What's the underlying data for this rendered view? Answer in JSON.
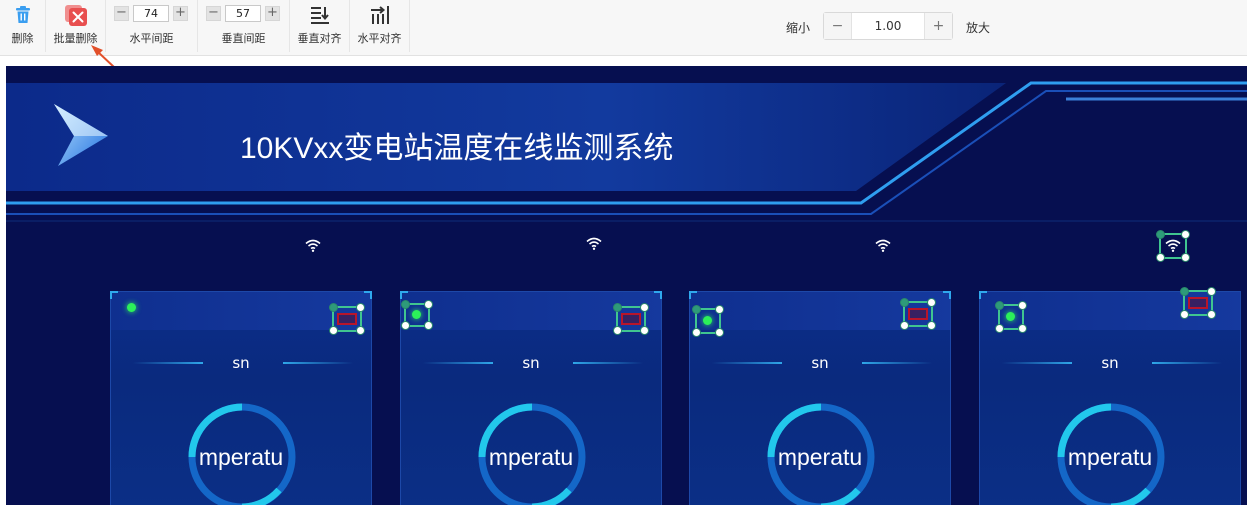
{
  "toolbar": {
    "delete_label": "删除",
    "batch_delete_label": "批量删除",
    "h_spacing_label": "水平间距",
    "h_spacing_value": "74",
    "v_spacing_label": "垂直间距",
    "v_spacing_value": "57",
    "v_align_label": "垂直对齐",
    "h_align_label": "水平对齐",
    "minus": "−",
    "plus": "+",
    "zoom_out_label": "缩小",
    "zoom_value": "1.00",
    "zoom_in_label": "放大"
  },
  "canvas": {
    "title": "10KVxx变电站温度在线监测系统",
    "cards": [
      {
        "sn": "sn",
        "gauge_text": "mperatu"
      },
      {
        "sn": "sn",
        "gauge_text": "mperatu"
      },
      {
        "sn": "sn",
        "gauge_text": "mperatu"
      },
      {
        "sn": "sn",
        "gauge_text": "mperatu"
      }
    ]
  },
  "colors": {
    "canvas_bg": "#060f50",
    "accent_cyan": "#2fa8ee",
    "selection_green": "#40c590",
    "delete_red": "#e84f4f",
    "trash_blue": "#3a9ef0"
  },
  "icons": [
    "trash-icon",
    "batch-delete-icon",
    "vertical-align-icon",
    "horizontal-align-icon",
    "wifi-icon",
    "arrow-logo-icon"
  ]
}
